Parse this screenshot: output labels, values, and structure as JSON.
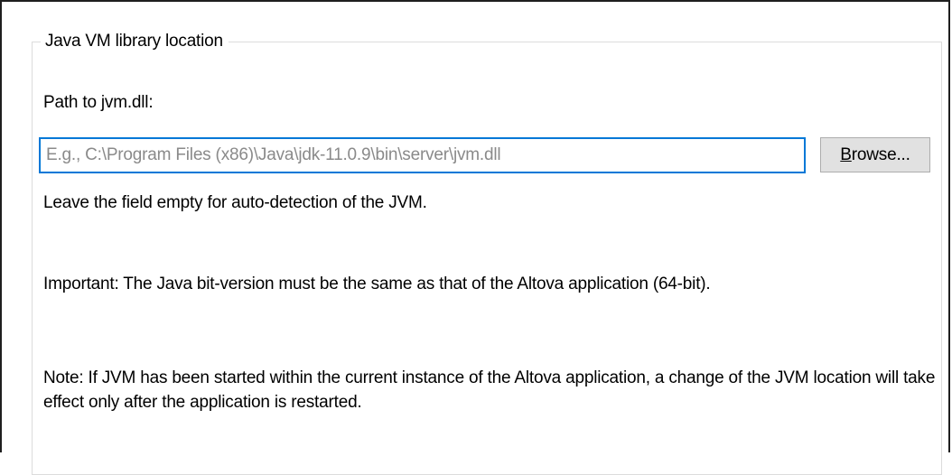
{
  "group": {
    "title": "Java VM library location"
  },
  "path": {
    "label": "Path to jvm.dll:",
    "value": "",
    "placeholder": "E.g., C:\\Program Files (x86)\\Java\\jdk-11.0.9\\bin\\server\\jvm.dll"
  },
  "browse_button": {
    "mnemonic": "B",
    "label_rest": "rowse..."
  },
  "hint": "Leave the field empty for auto-detection of the JVM.",
  "important": "Important: The Java bit-version must be the same as that of the Altova application (64-bit).",
  "note": "Note: If JVM has been started within the current instance of the Altova application, a change of the JVM location will take effect only after the application is restarted.",
  "colors": {
    "input_focus_border": "#0078d7",
    "button_face": "#e1e1e1",
    "button_border": "#adadad",
    "group_border": "#dcdcdc",
    "placeholder_text": "#8a8a8a"
  }
}
